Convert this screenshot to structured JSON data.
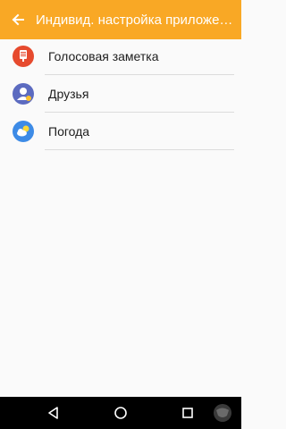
{
  "app_bar": {
    "title": "Индивид. настройка приложений",
    "back_icon": "arrow-left-icon",
    "background_color": "#f9a825"
  },
  "list": {
    "items": [
      {
        "label": "Голосовая заметка",
        "icon": "voice-memo-icon",
        "icon_color": "#e64a2e"
      },
      {
        "label": "Друзья",
        "icon": "contacts-icon",
        "icon_color": "#5c6bc0"
      },
      {
        "label": "Погода",
        "icon": "weather-icon",
        "icon_color": "#3d8be6"
      }
    ]
  },
  "nav_bar": {
    "buttons": [
      "back-triangle-icon",
      "home-circle-icon",
      "recents-square-icon"
    ]
  }
}
